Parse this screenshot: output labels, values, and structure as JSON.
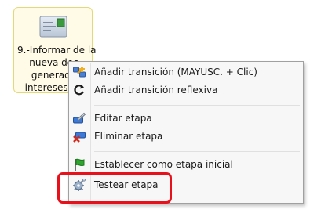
{
  "stage": {
    "label_lines": [
      "9.-Informar de la",
      "nueva dec",
      "generada",
      "intereses de"
    ],
    "icon": "envelope-stamp-icon"
  },
  "context_menu": {
    "items": [
      {
        "label": "Añadir transición (MAYUSC. + Clic)",
        "icon": "add-transition-icon"
      },
      {
        "label": "Añadir transición reflexiva",
        "icon": "reflexive-arrow-icon"
      },
      {
        "label": "Editar etapa",
        "icon": "edit-stage-icon"
      },
      {
        "label": "Eliminar etapa",
        "icon": "delete-stage-icon"
      },
      {
        "label": "Establecer como etapa inicial",
        "icon": "green-flag-icon"
      },
      {
        "label": "Testear etapa",
        "icon": "test-gear-icon"
      }
    ]
  },
  "annotation": {
    "highlight_color": "#e8101a",
    "target": "Testear etapa"
  }
}
